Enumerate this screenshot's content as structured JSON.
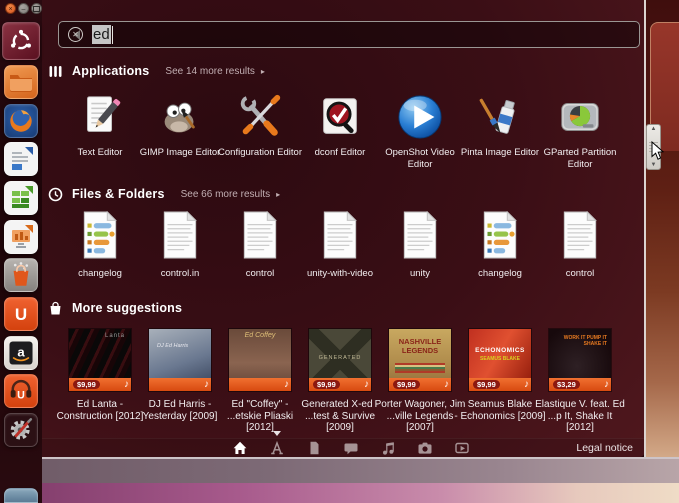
{
  "window_controls": {
    "close": "×",
    "minimize": "–",
    "maximize": ""
  },
  "search": {
    "value": "ed"
  },
  "sections": {
    "applications": {
      "title": "Applications",
      "more_link": "See 14 more results",
      "items": [
        {
          "label": "Text Editor",
          "icon": "text-editor-icon"
        },
        {
          "label": "GIMP Image Editor",
          "icon": "gimp-icon"
        },
        {
          "label": "Configuration Editor",
          "icon": "configuration-editor-icon"
        },
        {
          "label": "dconf Editor",
          "icon": "dconf-editor-icon"
        },
        {
          "label": "OpenShot Video Editor",
          "icon": "openshot-icon"
        },
        {
          "label": "Pinta Image Editor",
          "icon": "pinta-icon"
        },
        {
          "label": "GParted Partition Editor",
          "icon": "gparted-icon"
        }
      ]
    },
    "files": {
      "title": "Files & Folders",
      "more_link": "See 66 more results",
      "items": [
        {
          "label": "changelog",
          "icon": "changelog-doc-icon"
        },
        {
          "label": "control.in",
          "icon": "text-doc-icon"
        },
        {
          "label": "control",
          "icon": "text-doc-icon"
        },
        {
          "label": "unity-with-video",
          "icon": "text-doc-icon"
        },
        {
          "label": "unity",
          "icon": "text-doc-icon"
        },
        {
          "label": "changelog",
          "icon": "changelog-doc-icon"
        },
        {
          "label": "control",
          "icon": "text-doc-icon"
        }
      ]
    },
    "suggestions": {
      "title": "More suggestions",
      "items": [
        {
          "line1": "Ed Lanta -",
          "line2": "Construction [2012]",
          "price": "$9,99",
          "cover_text": "Lanta"
        },
        {
          "line1": "DJ Ed Harris -",
          "line2": "Yesterday [2009]",
          "price": "",
          "cover_text": "DJ Ed Harris"
        },
        {
          "line1": "Ed \"Coffey\" -",
          "line2": "...etskie Pliaski [2012]",
          "price": "",
          "cover_text": "Ed Coffey"
        },
        {
          "line1": "Generated X-ed -",
          "line2": "...test & Survive [2009]",
          "price": "$9,99",
          "cover_text": "GENERATED"
        },
        {
          "line1": "Porter Wagoner, Jim",
          "line2": "...ville Legends [2007]",
          "price": "$9,99",
          "cover_text": "NASHVILLE LEGENDS"
        },
        {
          "line1": "Seamus Blake",
          "line2": "- Echonomics [2009]",
          "price": "$9,99",
          "cover_text": "ECHONOMICS",
          "cover_text2": "SEAMUS BLAKE"
        },
        {
          "line1": "Elastique V. feat. Ed",
          "line2": "...p It, Shake It [2012]",
          "price": "$3,29",
          "cover_text": "WORK IT PUMP IT SHAKE IT"
        }
      ]
    }
  },
  "lens_bar": {
    "lenses": [
      {
        "icon": "home-icon",
        "active": true
      },
      {
        "icon": "applications-lens-icon",
        "active": false
      },
      {
        "icon": "files-lens-icon",
        "active": false
      },
      {
        "icon": "social-lens-icon",
        "active": false
      },
      {
        "icon": "music-lens-icon",
        "active": false
      },
      {
        "icon": "photos-lens-icon",
        "active": false
      },
      {
        "icon": "videos-lens-icon",
        "active": false
      }
    ],
    "legal_notice": "Legal notice"
  },
  "launcher": {
    "items": [
      "dash-home",
      "files-folder",
      "firefox",
      "libreoffice-writer",
      "libreoffice-calc",
      "libreoffice-impress",
      "software-center",
      "ubuntu-one",
      "amazon",
      "ubuntu-one-music",
      "system-settings"
    ],
    "ubuntu_one_letter": "U",
    "amazon_letter": "a",
    "music_note": "♪"
  },
  "colors": {
    "accent_orange": "#dd4814",
    "price_strip": "#e0561c",
    "dash_bg": "#3a0e15"
  }
}
